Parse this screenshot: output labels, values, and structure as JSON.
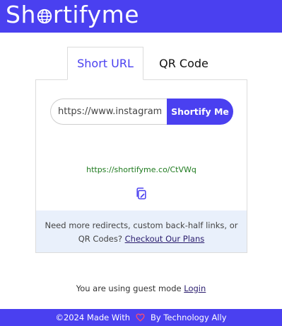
{
  "header": {
    "brand_part1": "Sh",
    "brand_part2": "rtifyme",
    "brand_color": "#4a40f0"
  },
  "tabs": [
    {
      "label": "Short URL",
      "active": true
    },
    {
      "label": "QR Code",
      "active": false
    }
  ],
  "shortener": {
    "input_value": "https://www.instagram.com/",
    "button_label": "Shortify Me",
    "result_url": "https://shortifyme.co/CtVWq",
    "copy_icon": "copy-icon"
  },
  "promo": {
    "text": "Need more redirects, custom back-half links, or QR Codes?",
    "link": "Checkout Our Plans"
  },
  "guest": {
    "text": "You are using guest mode",
    "link": "Login"
  },
  "footer": {
    "prefix": "©2024 Made With",
    "suffix": "By Technology Ally",
    "heart_color": "#ff4d6d"
  }
}
